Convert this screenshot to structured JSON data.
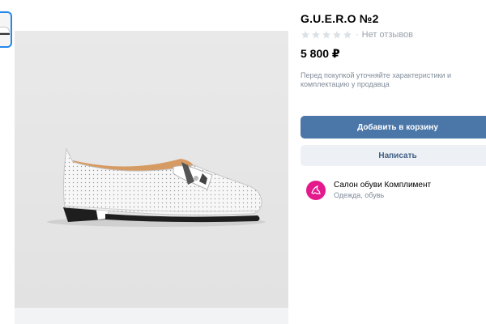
{
  "product": {
    "title": "G.U.E.R.O №2",
    "rating_stars": 0,
    "rating_max": 5,
    "reviews_separator": "·",
    "reviews_text": "Нет отзывов",
    "price": "5 800 ₽",
    "notice": "Перед покупкой уточняйте характеристики и комплектацию у продавца"
  },
  "actions": {
    "add_to_cart": "Добавить в корзину",
    "write": "Написать"
  },
  "seller": {
    "name": "Салон обуви Комплимент",
    "category": "Одежда, обувь"
  },
  "colors": {
    "accent": "#4a76a8",
    "secondary_bg": "#edf0f4",
    "secondary_text": "#3f5f86",
    "avatar": "#e3198c",
    "star_empty": "#dce1e6"
  },
  "icons": {
    "star": "star-icon",
    "avatar": "seller-logo-icon"
  }
}
